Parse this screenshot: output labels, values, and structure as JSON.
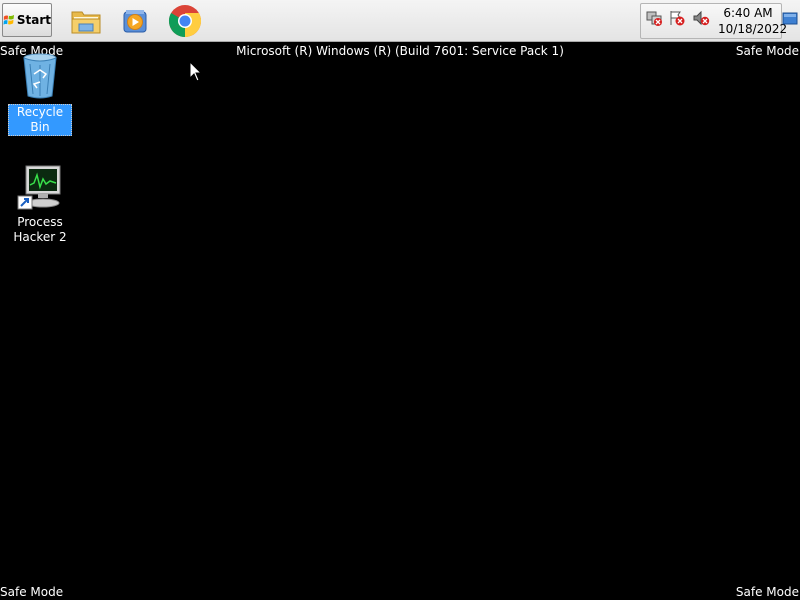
{
  "taskbar": {
    "start_label": "Start",
    "quick_launch": [
      {
        "name": "Windows Explorer",
        "icon": "folder-icon"
      },
      {
        "name": "Windows Media Player",
        "icon": "media-player-icon"
      },
      {
        "name": "Google Chrome",
        "icon": "chrome-icon"
      }
    ],
    "tray_icons": [
      "network-icon",
      "action-center-icon",
      "volume-muted-icon"
    ],
    "clock": {
      "time": "6:40 AM",
      "date": "10/18/2022"
    }
  },
  "desktop": {
    "background_color": "#000000",
    "watermark": {
      "top_left": "Safe Mode",
      "top_right": "Safe Mode",
      "bottom_left": "Safe Mode",
      "bottom_right": "Safe Mode",
      "build": "Microsoft (R) Windows (R) (Build 7601: Service Pack 1)"
    },
    "icons": [
      {
        "label": "Recycle Bin",
        "icon": "recycle-bin-icon",
        "selected": true
      },
      {
        "label": "Process Hacker 2",
        "label_line1": "Process",
        "label_line2": "Hacker 2",
        "icon": "process-hacker-icon",
        "selected": false
      }
    ]
  }
}
